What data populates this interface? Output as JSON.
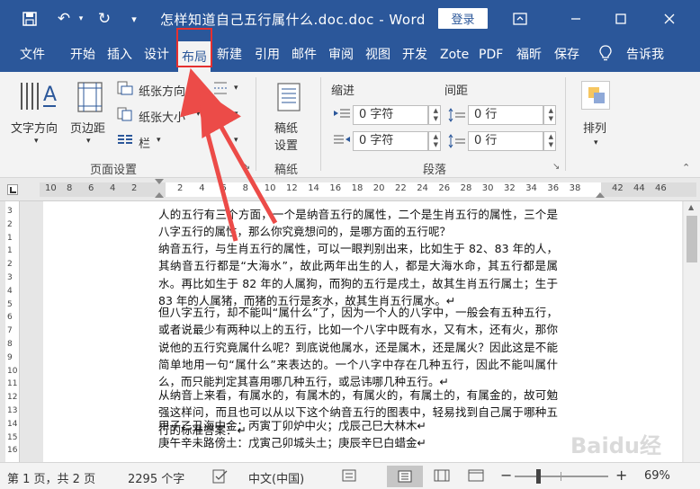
{
  "titlebar": {
    "document_title": "怎样知道自己五行属什么.doc.doc  -  Word",
    "login_label": "登录"
  },
  "tabs": [
    {
      "label": "文件"
    },
    {
      "label": "开始"
    },
    {
      "label": "插入"
    },
    {
      "label": "设计"
    },
    {
      "label": "布局"
    },
    {
      "label": "新建"
    },
    {
      "label": "引用"
    },
    {
      "label": "邮件"
    },
    {
      "label": "审阅"
    },
    {
      "label": "视图"
    },
    {
      "label": "开发"
    },
    {
      "label": "Zote"
    },
    {
      "label": "PDF"
    },
    {
      "label": "福昕"
    },
    {
      "label": "保存"
    },
    {
      "label": "告诉我"
    }
  ],
  "ribbon": {
    "page_setup": {
      "text_direction": "文字方向",
      "margins": "页边距",
      "orientation": "纸张方向",
      "size": "纸张大小",
      "columns": "栏",
      "group_label": "页面设置"
    },
    "manuscript": {
      "settings_line1": "稿纸",
      "settings_line2": "设置",
      "group_label": "稿纸"
    },
    "paragraph": {
      "indent_label": "缩进",
      "spacing_label": "间距",
      "indent_left": "0 字符",
      "indent_right": "0 字符",
      "space_before": "0 行",
      "space_after": "0 行",
      "group_label": "段落"
    },
    "arrange": {
      "label": "排列"
    }
  },
  "ruler": {
    "left_ticks": [
      "10",
      "8",
      "6",
      "4",
      "2"
    ],
    "mid_ticks": [
      "2",
      "4",
      "6",
      "8",
      "10",
      "12",
      "14",
      "16",
      "18",
      "20",
      "22",
      "24",
      "26",
      "28",
      "30",
      "32",
      "34",
      "36",
      "38"
    ],
    "right_ticks": [
      "42",
      "44",
      "46"
    ],
    "vertical_ticks": [
      "3",
      "2",
      "1",
      "1",
      "2",
      "3",
      "4",
      "5",
      "6",
      "7",
      "8",
      "9",
      "10",
      "11",
      "12",
      "13",
      "14",
      "15",
      "16"
    ]
  },
  "document": {
    "paragraphs": [
      "人的五行有三个方面，一个是纳音五行的属性，二个是生肖五行的属性，三个是八字五行的属性，那么你究竟想问的，是哪方面的五行呢？",
      "纳音五行，与生肖五行的属性，可以一眼判别出来，比如生于 82、83 年的人，其纳音五行都是“大海水”，故此两年出生的人，都是大海水命，其五行都是属水。再比如生于 82 年的人属狗，而狗的五行是戌土，故其生肖五行属土；生于 83 年的人属猪，而猪的五行是亥水，故其生肖五行属水。↵",
      "但八字五行，却不能叫“属什么”了，因为一个人的八字中，一般会有五种五行，或者说最少有两种以上的五行，比如一个八字中既有水，又有木，还有火，那你说他的五行究竟属什么呢？到底说他属水，还是属木，还是属火？因此这是不能简单地用一句“属什么”来表达的。一个八字中存在几种五行，因此不能叫属什么，而只能判定其喜用哪几种五行，或忌讳哪几种五行。↵",
      "从纳音上来看，有属水的，有属木的，有属火的，有属土的，有属金的，故可勉强这样问，而且也可以从以下这个纳音五行的图表中，轻易找到自己属于哪种五行的标准答案：↵",
      "甲子乙丑海中金：丙寅丁卯炉中火；戊辰己巳大林木↵",
      "庚午辛未路傍土：戊寅己卯城头土；庚辰辛巳白蜡金↵"
    ]
  },
  "statusbar": {
    "page_info": "第 1 页，共 2 页",
    "word_count": "2295 个字",
    "language": "中文(中国)",
    "zoom": "69%",
    "zoom_minus": "−",
    "zoom_plus": "+"
  },
  "watermark": "Baidu经验",
  "colors": {
    "word_blue": "#2b579a",
    "highlight_red": "#e5302f",
    "arrow_red": "#ec4b48"
  }
}
